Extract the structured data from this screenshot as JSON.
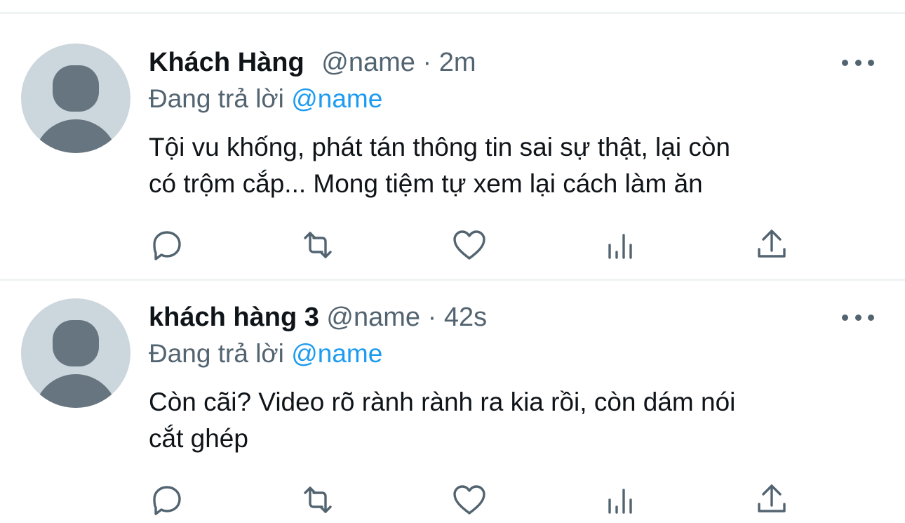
{
  "tweets": [
    {
      "display_name": "Khách Hàng",
      "handle": "@name",
      "separator": "·",
      "time": "2m",
      "reply_prefix": "Đang trả lời",
      "reply_handle": "@name",
      "text_lines": [
        "Tội vu khống, phát tán thông tin sai sự thật, lại còn",
        "có trộm cắp... Mong tiệm  tự xem lại cách làm ăn"
      ],
      "actions": [
        "reply-icon",
        "retweet-icon",
        "like-icon",
        "analytics-icon",
        "share-icon"
      ]
    },
    {
      "display_name": "khách hàng 3",
      "handle": "@name",
      "separator": "·",
      "time": "42s",
      "reply_prefix": "Đang trả lời",
      "reply_handle": "@name",
      "text_lines": [
        "Còn cãi? Video rõ rành rành ra kia rồi, còn dám nói",
        "cắt ghép"
      ],
      "actions": [
        "reply-icon",
        "retweet-icon",
        "like-icon",
        "analytics-icon",
        "share-icon"
      ]
    }
  ],
  "colors": {
    "text_primary": "#0f1419",
    "text_secondary": "#536471",
    "accent_link": "#1d9bf0",
    "avatar_bg": "#ccd6dd",
    "avatar_figure": "#66757f",
    "divider": "#eff3f4"
  }
}
